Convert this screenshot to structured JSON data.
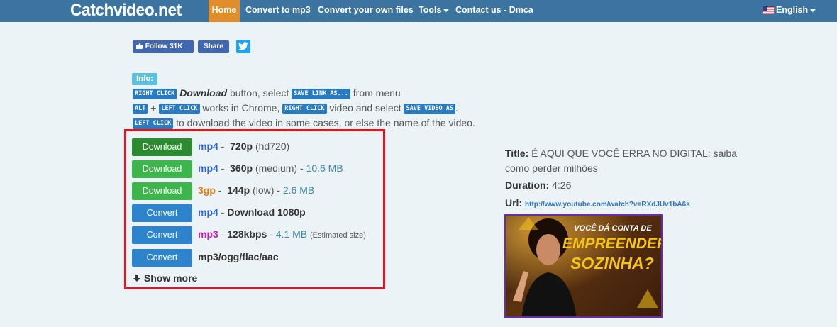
{
  "nav": {
    "brand": "Catchvideo.net",
    "items": [
      {
        "label": "Home"
      },
      {
        "label": "Convert to mp3"
      },
      {
        "label": "Convert your own files"
      },
      {
        "label": "Tools"
      },
      {
        "label": "Contact us - Dmca"
      }
    ],
    "language": "English"
  },
  "social": {
    "follow_label": "Follow 31K",
    "share_label": "Share",
    "icons": [
      "facebook-like-icon",
      "twitter-icon"
    ]
  },
  "info": {
    "label": "Info:",
    "line1": {
      "kbd1": "RIGHT CLICK",
      "em": "Download",
      "t1": " button, select ",
      "kbd2": "SAVE LINK AS...",
      "t2": " from menu"
    },
    "line2": {
      "kbd1": "ALT",
      "t1": " + ",
      "kbd2": "LEFT CLICK",
      "t2": " works in Chrome, ",
      "kbd3": "RIGHT CLICK",
      "t3": " video and select ",
      "kbd4": "SAVE VIDEO AS",
      "t4": "."
    },
    "line3": {
      "kbd1": "LEFT CLICK",
      "t1": " to download the video in some cases, or else the name of the video."
    }
  },
  "downloads": [
    {
      "button": "Download",
      "format": "mp4",
      "sep1": " - ",
      "res": "720p",
      "quality": "(hd720)"
    },
    {
      "button": "Download",
      "format": "mp4",
      "sep1": " - ",
      "res": "360p",
      "quality": "(medium)",
      "sep2": " - ",
      "size": "10.6 MB"
    },
    {
      "button": "Download",
      "format": "3gp",
      "sep1": " - ",
      "res": "144p",
      "quality": "(low)",
      "sep2": " - ",
      "size": "2.6 MB"
    },
    {
      "button": "Convert",
      "format": "mp4",
      "sep1": " - ",
      "res": "Download 1080p"
    },
    {
      "button": "Convert",
      "format": "mp3",
      "sep1": " - ",
      "res": "128kbps",
      "sep2": " - ",
      "size": "4.1 MB",
      "note": "(Estimated size)"
    },
    {
      "button": "Convert",
      "res": "mp3/ogg/flac/aac"
    }
  ],
  "show_more": "Show more",
  "video": {
    "title_label": "Title:",
    "title": "É AQUI QUE VOCÊ ERRA NO DIGITAL: saiba como perder milhões",
    "duration_label": "Duration:",
    "duration": "4:26",
    "url_label": "Url:",
    "url": "http://www.youtube.com/watch?v=RXdJUv1bA6s",
    "thumb_lines": [
      "VOCÊ DÁ CONTA DE",
      "EMPREENDER",
      "SOZINHA?"
    ]
  },
  "colors": {
    "navbar": "#3c74a0",
    "home_active": "#e08e2b",
    "highlight_border": "#e0151f",
    "download_primary": "#2c8a2f",
    "download": "#3cb54a",
    "convert": "#2d83cc"
  }
}
